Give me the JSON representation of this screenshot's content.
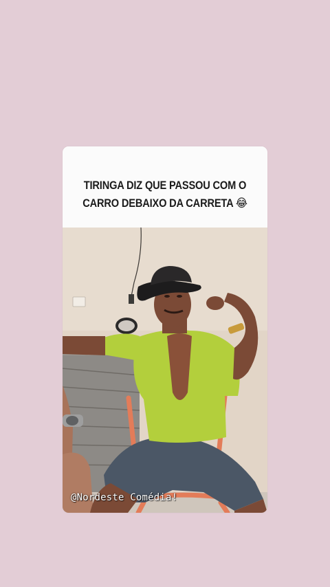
{
  "post": {
    "caption_line1": "TIRINGA DIZ QUE PASSOU COM O",
    "caption_line2": "CARRO DEBAIXO DA CARRETA",
    "caption_emoji": "😂",
    "watermark": "@Nordeste Comédia!"
  },
  "colors": {
    "page_background": "#e3cdd6",
    "card_background": "#fbfbfb",
    "shirt": "#b3cf3c",
    "chair": "#e37c59",
    "shorts": "#4b5766",
    "hat": "#1d1c1d",
    "wall": "#e2d5c7"
  }
}
